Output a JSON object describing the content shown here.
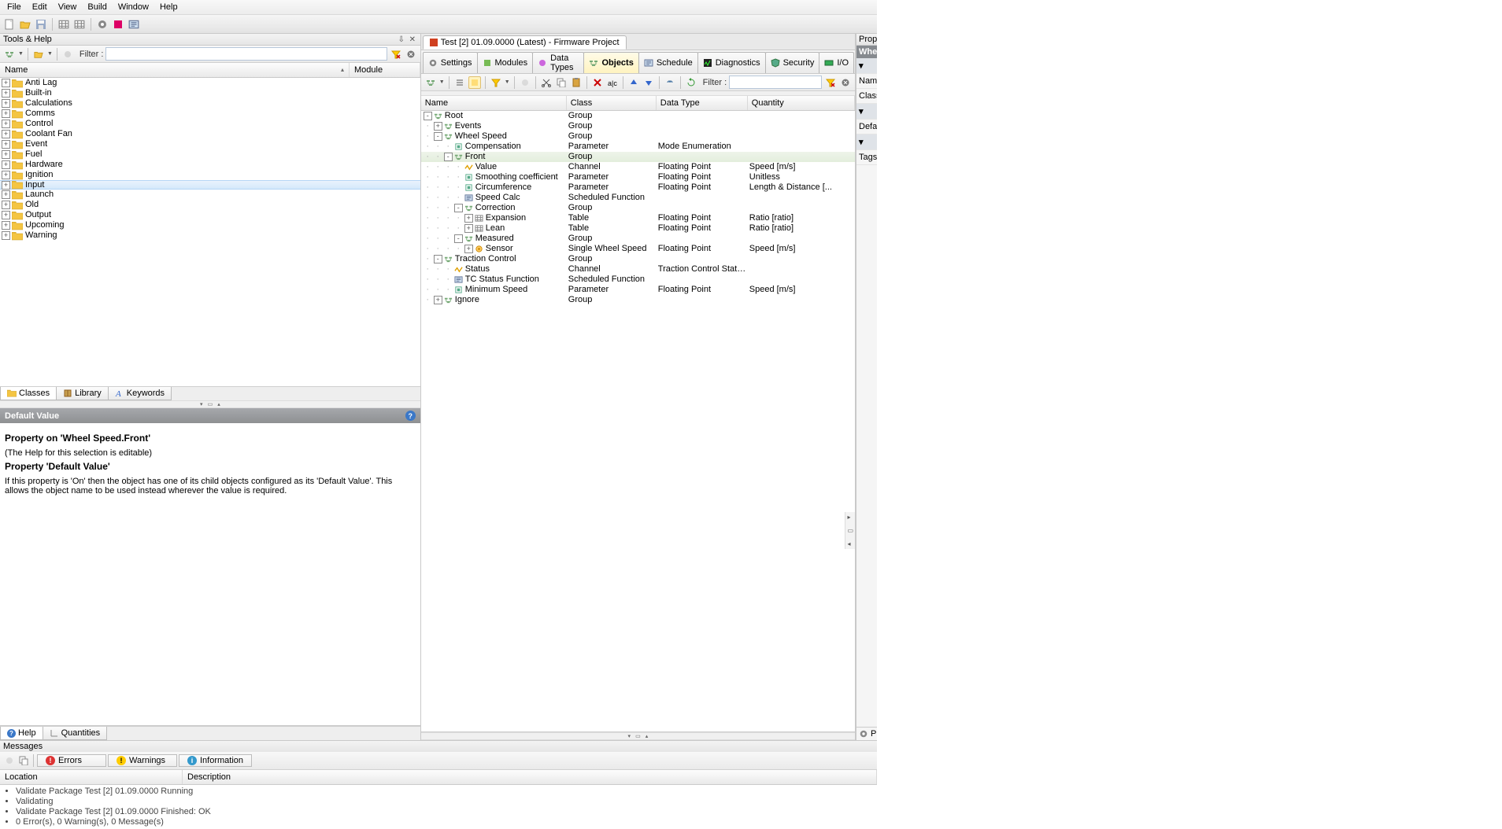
{
  "menu": {
    "file": "File",
    "edit": "Edit",
    "view": "View",
    "build": "Build",
    "window": "Window",
    "help": "Help"
  },
  "leftPanel": {
    "title": "Tools & Help",
    "filterLabel": "Filter :",
    "cols": {
      "name": "Name",
      "module": "Module"
    },
    "items": [
      "Anti Lag",
      "Built-in",
      "Calculations",
      "Comms",
      "Control",
      "Coolant Fan",
      "Event",
      "Fuel",
      "Hardware",
      "Ignition",
      "Input",
      "Launch",
      "Old",
      "Output",
      "Upcoming",
      "Warning"
    ],
    "selectedIndex": 10,
    "tabs": {
      "classes": "Classes",
      "library": "Library",
      "keywords": "Keywords"
    }
  },
  "helpPanel": {
    "title": "Default Value",
    "h1": "Property on 'Wheel Speed.Front'",
    "p1": "(The Help for this selection is editable)",
    "h2": "Property 'Default Value'",
    "p2": "If this property is 'On' then the object has one of its child objects configured as its 'Default Value'. This allows the object name to be used instead wherever the value is required.",
    "tabs": {
      "help": "Help",
      "quantities": "Quantities"
    }
  },
  "midPanel": {
    "docTab": "Test [2] 01.09.0000 (Latest) - Firmware Project",
    "tabs": {
      "settings": "Settings",
      "modules": "Modules",
      "datatypes": "Data Types",
      "objects": "Objects",
      "schedule": "Schedule",
      "diagnostics": "Diagnostics",
      "security": "Security",
      "io": "I/O"
    },
    "filterLabel": "Filter :",
    "cols": {
      "name": "Name",
      "class": "Class",
      "dt": "Data Type",
      "qty": "Quantity"
    },
    "rows": [
      {
        "depth": 0,
        "exp": "-",
        "ico": "group",
        "name": "Root",
        "class": "Group",
        "dt": "",
        "qty": ""
      },
      {
        "depth": 1,
        "exp": "+",
        "ico": "group",
        "name": "Events",
        "class": "Group",
        "dt": "",
        "qty": ""
      },
      {
        "depth": 1,
        "exp": "-",
        "ico": "group",
        "name": "Wheel Speed",
        "class": "Group",
        "dt": "",
        "qty": ""
      },
      {
        "depth": 2,
        "exp": "",
        "ico": "param",
        "name": "Compensation",
        "class": "Parameter",
        "dt": "Mode Enumeration",
        "qty": ""
      },
      {
        "depth": 2,
        "exp": "-",
        "ico": "group",
        "name": "Front",
        "class": "Group",
        "dt": "",
        "qty": "",
        "sel": true
      },
      {
        "depth": 3,
        "exp": "",
        "ico": "chan",
        "name": "Value",
        "class": "Channel",
        "dt": "Floating Point",
        "qty": "Speed [m/s]"
      },
      {
        "depth": 3,
        "exp": "",
        "ico": "param",
        "name": "Smoothing coefficient",
        "class": "Parameter",
        "dt": "Floating Point",
        "qty": "Unitless"
      },
      {
        "depth": 3,
        "exp": "",
        "ico": "param",
        "name": "Circumference",
        "class": "Parameter",
        "dt": "Floating Point",
        "qty": "Length & Distance [..."
      },
      {
        "depth": 3,
        "exp": "",
        "ico": "func",
        "name": "Speed Calc",
        "class": "Scheduled Function",
        "dt": "",
        "qty": ""
      },
      {
        "depth": 3,
        "exp": "-",
        "ico": "group",
        "name": "Correction",
        "class": "Group",
        "dt": "",
        "qty": ""
      },
      {
        "depth": 4,
        "exp": "+",
        "ico": "table",
        "name": "Expansion",
        "class": "Table",
        "dt": "Floating Point",
        "qty": "Ratio [ratio]"
      },
      {
        "depth": 4,
        "exp": "+",
        "ico": "table",
        "name": "Lean",
        "class": "Table",
        "dt": "Floating Point",
        "qty": "Ratio [ratio]"
      },
      {
        "depth": 3,
        "exp": "-",
        "ico": "group",
        "name": "Measured",
        "class": "Group",
        "dt": "",
        "qty": ""
      },
      {
        "depth": 4,
        "exp": "+",
        "ico": "sensor",
        "name": "Sensor",
        "class": "Single Wheel Speed",
        "dt": "Floating Point",
        "qty": "Speed [m/s]"
      },
      {
        "depth": 1,
        "exp": "-",
        "ico": "group",
        "name": "Traction Control",
        "class": "Group",
        "dt": "",
        "qty": ""
      },
      {
        "depth": 2,
        "exp": "",
        "ico": "chan",
        "name": "Status",
        "class": "Channel",
        "dt": "Traction Control Status Enu...",
        "qty": ""
      },
      {
        "depth": 2,
        "exp": "",
        "ico": "func",
        "name": "TC Status Function",
        "class": "Scheduled Function",
        "dt": "",
        "qty": ""
      },
      {
        "depth": 2,
        "exp": "",
        "ico": "param",
        "name": "Minimum Speed",
        "class": "Parameter",
        "dt": "Floating Point",
        "qty": "Speed [m/s]"
      },
      {
        "depth": 1,
        "exp": "+",
        "ico": "group",
        "name": "Ignore",
        "class": "Group",
        "dt": "",
        "qty": ""
      }
    ]
  },
  "messages": {
    "title": "Messages",
    "tabs": {
      "errors": "Errors",
      "warnings": "Warnings",
      "info": "Information"
    },
    "cols": {
      "loc": "Location",
      "desc": "Description"
    },
    "items": [
      "Validate Package Test [2] 01.09.0000 Running",
      "Validating",
      "Validate Package Test [2] 01.09.0000 Finished: OK",
      "0 Error(s), 0 Warning(s), 0 Message(s)"
    ]
  },
  "rightPanel": {
    "title": "Propert",
    "dark": "Whe",
    "rows": [
      "Name",
      "Class",
      "Defaul",
      "Tags"
    ],
    "bottom": "P"
  }
}
